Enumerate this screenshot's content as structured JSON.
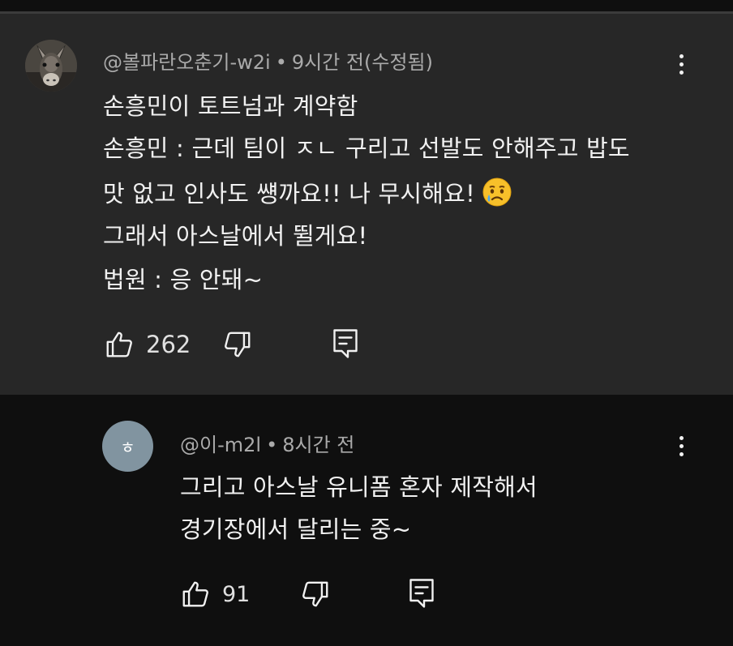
{
  "main_comment": {
    "author": "@볼파란오춘기-w2i",
    "separator": "•",
    "time": "9시간 전(수정됨)",
    "lines": [
      "손흥민이 토트넘과 계약함",
      "손흥민 : 근데 팀이 ㅈㄴ 구리고 선발도 안해주고 밥도",
      "맛 없고 인사도 썡까요!! 나 무시해요!",
      "그래서 아스날에서 뛸게요!",
      "법원 : 응 안돼~"
    ],
    "emoji": "crying-face",
    "like_count": "262"
  },
  "reply": {
    "avatar_letter": "ㅎ",
    "author": "@이-m2l",
    "separator": "•",
    "time": "8시간 전",
    "lines": [
      "그리고 아스날 유니폼 혼자 제작해서",
      "경기장에서 달리는 중~"
    ],
    "like_count": "91"
  },
  "colors": {
    "main_bg": "#272727",
    "page_bg": "#0f0f0f",
    "meta_text": "#aaaaaa",
    "body_text": "#f1f1f1",
    "reply_avatar": "#8194a0"
  }
}
